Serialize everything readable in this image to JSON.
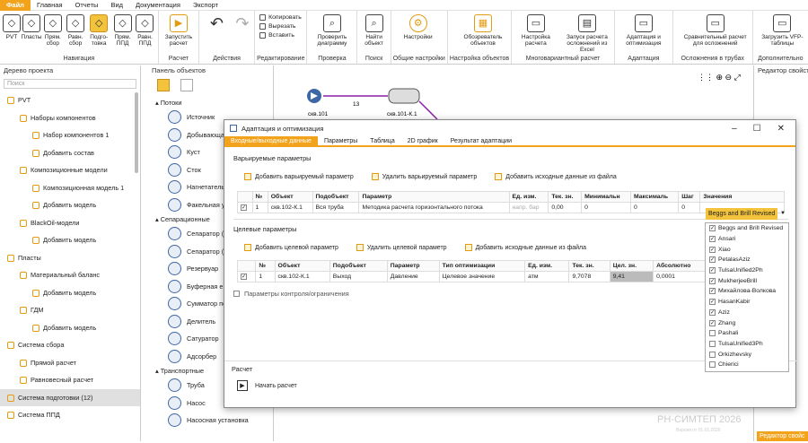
{
  "menu": [
    "Файл",
    "Главная",
    "Отчеты",
    "Вид",
    "Документация",
    "Экспорт"
  ],
  "ribbon": {
    "nav": {
      "name": "Навигация",
      "items": [
        "PVT",
        "Пласты",
        "Прям. сбор",
        "Равн. сбор",
        "Подго-товка",
        "Прям. ППД",
        "Равн. ППД"
      ]
    },
    "calc": {
      "name": "Расчет",
      "item": "Запустить расчет"
    },
    "actions": {
      "name": "Действия"
    },
    "edit": {
      "name": "Редактирование",
      "items": [
        "Копировать",
        "Вырезать",
        "Вставить"
      ]
    },
    "check": {
      "name": "Проверка",
      "item": "Проверить диаграмму"
    },
    "search": {
      "name": "Поиск",
      "item": "Найти объект"
    },
    "settings": {
      "name": "Общие настройки",
      "item": "Настройки"
    },
    "objsettings": {
      "name": "Настройка объектов",
      "item": "Обозреватель объектов"
    },
    "multi": {
      "name": "Многовариантный расчет",
      "items": [
        "Настройка расчета",
        "Запуск расчета осложнений из Excel"
      ]
    },
    "adapt": {
      "name": "Адаптация",
      "item": "Адаптация и оптимизация"
    },
    "pipes": {
      "name": "Осложнения в трубах",
      "item": "Сравнительный расчет для осложнений"
    },
    "extra": {
      "name": "Дополнительно",
      "item": "Загрузить VFP-таблицы"
    }
  },
  "left": {
    "title": "Дерево проекта",
    "search": "Поиск",
    "items": [
      "PVT",
      "Наборы компонентов",
      "Набор компонентов 1",
      "Добавить состав",
      "Композиционные модели",
      "Композиционная модель 1",
      "Добавить модель",
      "BlackOil-модели",
      "Добавить модель",
      "Пласты",
      "Материальный баланс",
      "Добавить модель",
      "ГДМ",
      "Добавить модель",
      "Система сбора",
      "Прямой расчет",
      "Равновесный расчет",
      "Система подготовки (12)",
      "Система ППД"
    ]
  },
  "objp": {
    "title": "Панель объектов",
    "sec1": "Потоки",
    "items1": [
      "Источник",
      "Добывающая",
      "Куст",
      "Сток",
      "Нагнетатель",
      "Факельная уст"
    ],
    "sec2": "Сепарационные",
    "items2": [
      "Сепаратор (д",
      "Сепаратор (т",
      "Резервуар",
      "Буферная ем",
      "Сумматор по",
      "Делитель",
      "Сатуратор",
      "Адсорбер"
    ],
    "sec3": "Транспортные",
    "items3": [
      "Труба",
      "Насос",
      "Насосная установка"
    ]
  },
  "canvas": {
    "n1": "скв.101",
    "n2": "скв.101-К.1",
    "edge": "13",
    "watermark": "РН-СИМТЕП 2026",
    "version": "Версия от 01.01.2026"
  },
  "props": {
    "title": "Редактор свойств",
    "btn": "Редактор свойс"
  },
  "dialog": {
    "title": "Адаптация и оптимизация",
    "tabs": [
      "Входные/выходные данные",
      "Параметры",
      "Таблица",
      "2D график",
      "Результат адаптации"
    ],
    "var": {
      "title": "Варьируемые параметры",
      "add": "Добавить варьируемый параметр",
      "del": "Удалить варьируемый параметр",
      "load": "Добавить исходные данные из файла",
      "headers": [
        "№",
        "Объект",
        "Подобъект",
        "Параметр",
        "Ед. изм.",
        "Тек. зн.",
        "Минимальн",
        "Максималь",
        "Шаг",
        "Значения"
      ],
      "row": [
        "1",
        "скв.102-К.1",
        "Вся труба",
        "Методика расчета горизонтального потока",
        "напр. бар",
        "0,00",
        "0",
        "0",
        "0",
        "Beggs and Brill Revised"
      ]
    },
    "tgt": {
      "title": "Целевые параметры",
      "add": "Добавить целевой параметр",
      "del": "Удалить целевой параметр",
      "load": "Добавить исходные данные из файла",
      "headers": [
        "№",
        "Объект",
        "Подобъект",
        "Параметр",
        "Тип оптимизации",
        "Ед. изм.",
        "Тек. зн.",
        "Цел. зн.",
        "Абсолютно"
      ],
      "row": [
        "1",
        "скв.102-К.1",
        "Выход",
        "Давление",
        "Целевое значение",
        "атм",
        "9,7078",
        "9,41",
        "0,0001"
      ]
    },
    "ctl": "Параметры контроля/ограничения",
    "run": {
      "title": "Расчет",
      "btn": "Начать расчет"
    },
    "dd": [
      {
        "t": "Beggs and Brill Revised",
        "c": true
      },
      {
        "t": "Ansari",
        "c": true
      },
      {
        "t": "Xiao",
        "c": true
      },
      {
        "t": "PetalasAziz",
        "c": true
      },
      {
        "t": "TulsaUnified2Ph",
        "c": true
      },
      {
        "t": "MukherjeeBrill",
        "c": true
      },
      {
        "t": "Михайлова-Волкова",
        "c": true
      },
      {
        "t": "HasanKabir",
        "c": true
      },
      {
        "t": "Aziz",
        "c": true
      },
      {
        "t": "Zhang",
        "c": true
      },
      {
        "t": "Pashali",
        "c": false
      },
      {
        "t": "TulsaUnified3Ph",
        "c": false
      },
      {
        "t": "Orkizhevsky",
        "c": false
      },
      {
        "t": "Chierici",
        "c": false
      }
    ]
  }
}
